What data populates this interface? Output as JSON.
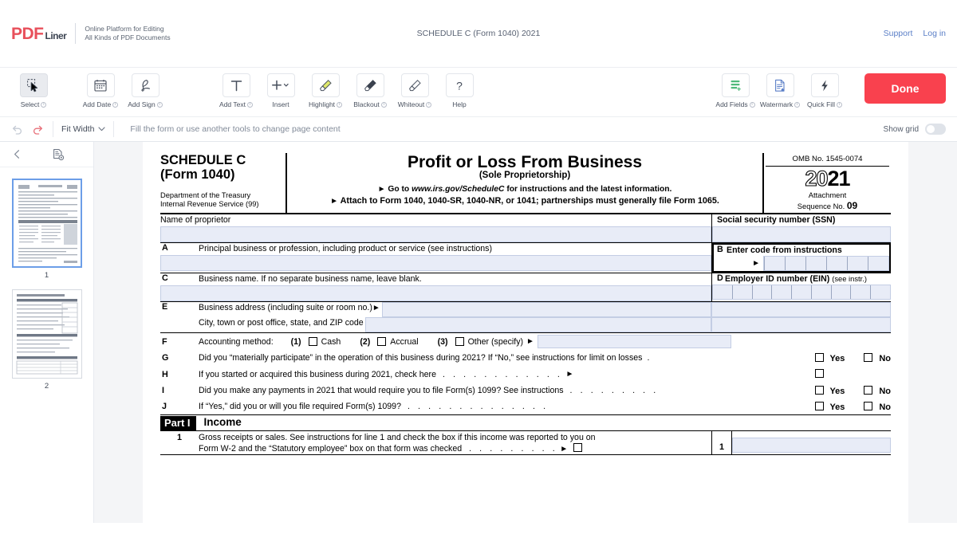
{
  "brand": {
    "logo_pdf": "PDF",
    "logo_liner": "Liner",
    "tagline_line1": "Online Platform for Editing",
    "tagline_line2": "All Kinds of PDF Documents"
  },
  "header": {
    "document_title": "SCHEDULE C (Form 1040) 2021",
    "support_label": "Support",
    "login_label": "Log in",
    "accent_color": "#e8505b"
  },
  "toolbar": {
    "tools": [
      {
        "label": "Select",
        "icon": "cursor-select-icon",
        "active": true,
        "info": true
      },
      {
        "label": "Add Date",
        "icon": "calendar-icon",
        "active": false,
        "info": true
      },
      {
        "label": "Add Sign",
        "icon": "signature-icon",
        "active": false,
        "info": true
      },
      {
        "label": "Add Text",
        "icon": "text-t-icon",
        "active": false,
        "info": true
      },
      {
        "label": "Insert",
        "icon": "plus-chevron-icon",
        "active": false,
        "info": false
      },
      {
        "label": "Highlight",
        "icon": "highlighter-icon",
        "active": false,
        "info": true
      },
      {
        "label": "Blackout",
        "icon": "blackout-brush-icon",
        "active": false,
        "info": true
      },
      {
        "label": "Whiteout",
        "icon": "whiteout-brush-icon",
        "active": false,
        "info": true
      },
      {
        "label": "Help",
        "icon": "question-mark-icon",
        "active": false,
        "info": false
      }
    ],
    "right_tools": [
      {
        "label": "Add Fields",
        "icon": "add-fields-icon",
        "info": true
      },
      {
        "label": "Watermark",
        "icon": "watermark-icon",
        "info": true
      },
      {
        "label": "Quick Fill",
        "icon": "lightning-icon",
        "info": true
      }
    ],
    "done_label": "Done",
    "done_color": "#f9414e"
  },
  "subbar": {
    "undo_icon": "undo-arrow-icon",
    "redo_icon": "redo-arrow-icon",
    "zoom_value": "Fit Width",
    "hint": "Fill the form or use another tools to change page content",
    "show_grid_label": "Show grid",
    "show_grid_on": false
  },
  "sidebar": {
    "collapse_icon": "chevron-left-icon",
    "page_tools_icon": "page-settings-icon",
    "pages": [
      {
        "number": "1",
        "selected": true
      },
      {
        "number": "2",
        "selected": false
      }
    ]
  },
  "form": {
    "schedule_title": "SCHEDULE C",
    "schedule_form": "(Form 1040)",
    "dept_line1": "Department of the Treasury",
    "dept_line2": "Internal Revenue Service (99)",
    "main_title": "Profit or Loss From Business",
    "subtitle": "(Sole Proprietorship)",
    "goto_prefix": "Go to",
    "goto_url": "www.irs.gov/ScheduleC",
    "goto_suffix": "for instructions and the latest information.",
    "attach_text": "Attach to Form 1040, 1040-SR, 1040-NR, or 1041; partnerships must generally file Form 1065.",
    "omb": "OMB No. 1545-0074",
    "year_dim": "20",
    "year_bold": "21",
    "attachment_label": "Attachment",
    "sequence_label": "Sequence No.",
    "sequence_number": "09",
    "name_of_proprietor": "Name of proprietor",
    "ssn_label": "Social security number (SSN)",
    "line_a_letter": "A",
    "line_a_text": "Principal business or profession, including product or service (see instructions)",
    "line_b_letter": "B",
    "line_b_text": "Enter code from instructions",
    "line_c_letter": "C",
    "line_c_text": "Business name. If no separate business name, leave blank.",
    "line_d_letter": "D",
    "line_d_text": "Employer ID number (EIN)",
    "line_d_note": "(see instr.)",
    "line_e_letter": "E",
    "line_e_text": "Business address (including suite or room no.)",
    "line_e_text2": "City, town or post office, state, and ZIP code",
    "line_f_letter": "F",
    "line_f_text": "Accounting method:",
    "line_f_opt1_num": "(1)",
    "line_f_opt1": "Cash",
    "line_f_opt2_num": "(2)",
    "line_f_opt2": "Accrual",
    "line_f_opt3_num": "(3)",
    "line_f_opt3": "Other (specify)",
    "line_g_letter": "G",
    "line_g_text": "Did you “materially participate” in the operation of this business during 2021? If “No,” see instructions for limit on losses",
    "line_h_letter": "H",
    "line_h_text": "If you started or acquired this business during 2021, check here",
    "line_i_letter": "I",
    "line_i_text": "Did you make any payments in 2021 that would require you to file Form(s) 1099? See instructions",
    "line_j_letter": "J",
    "line_j_text": "If “Yes,” did you or will you file required Form(s) 1099?",
    "yes_label": "Yes",
    "no_label": "No",
    "part_tag": "Part I",
    "part_name": "Income",
    "line_1_num": "1",
    "line_1_text": "Gross receipts or sales. See instructions for line 1 and check the box if this income was reported to you on",
    "line_1_text2": "Form W-2 and the “Statutory employee” box on that form was checked",
    "line_1_rownum": "1",
    "field_fill_color": "#e8ecf7"
  }
}
